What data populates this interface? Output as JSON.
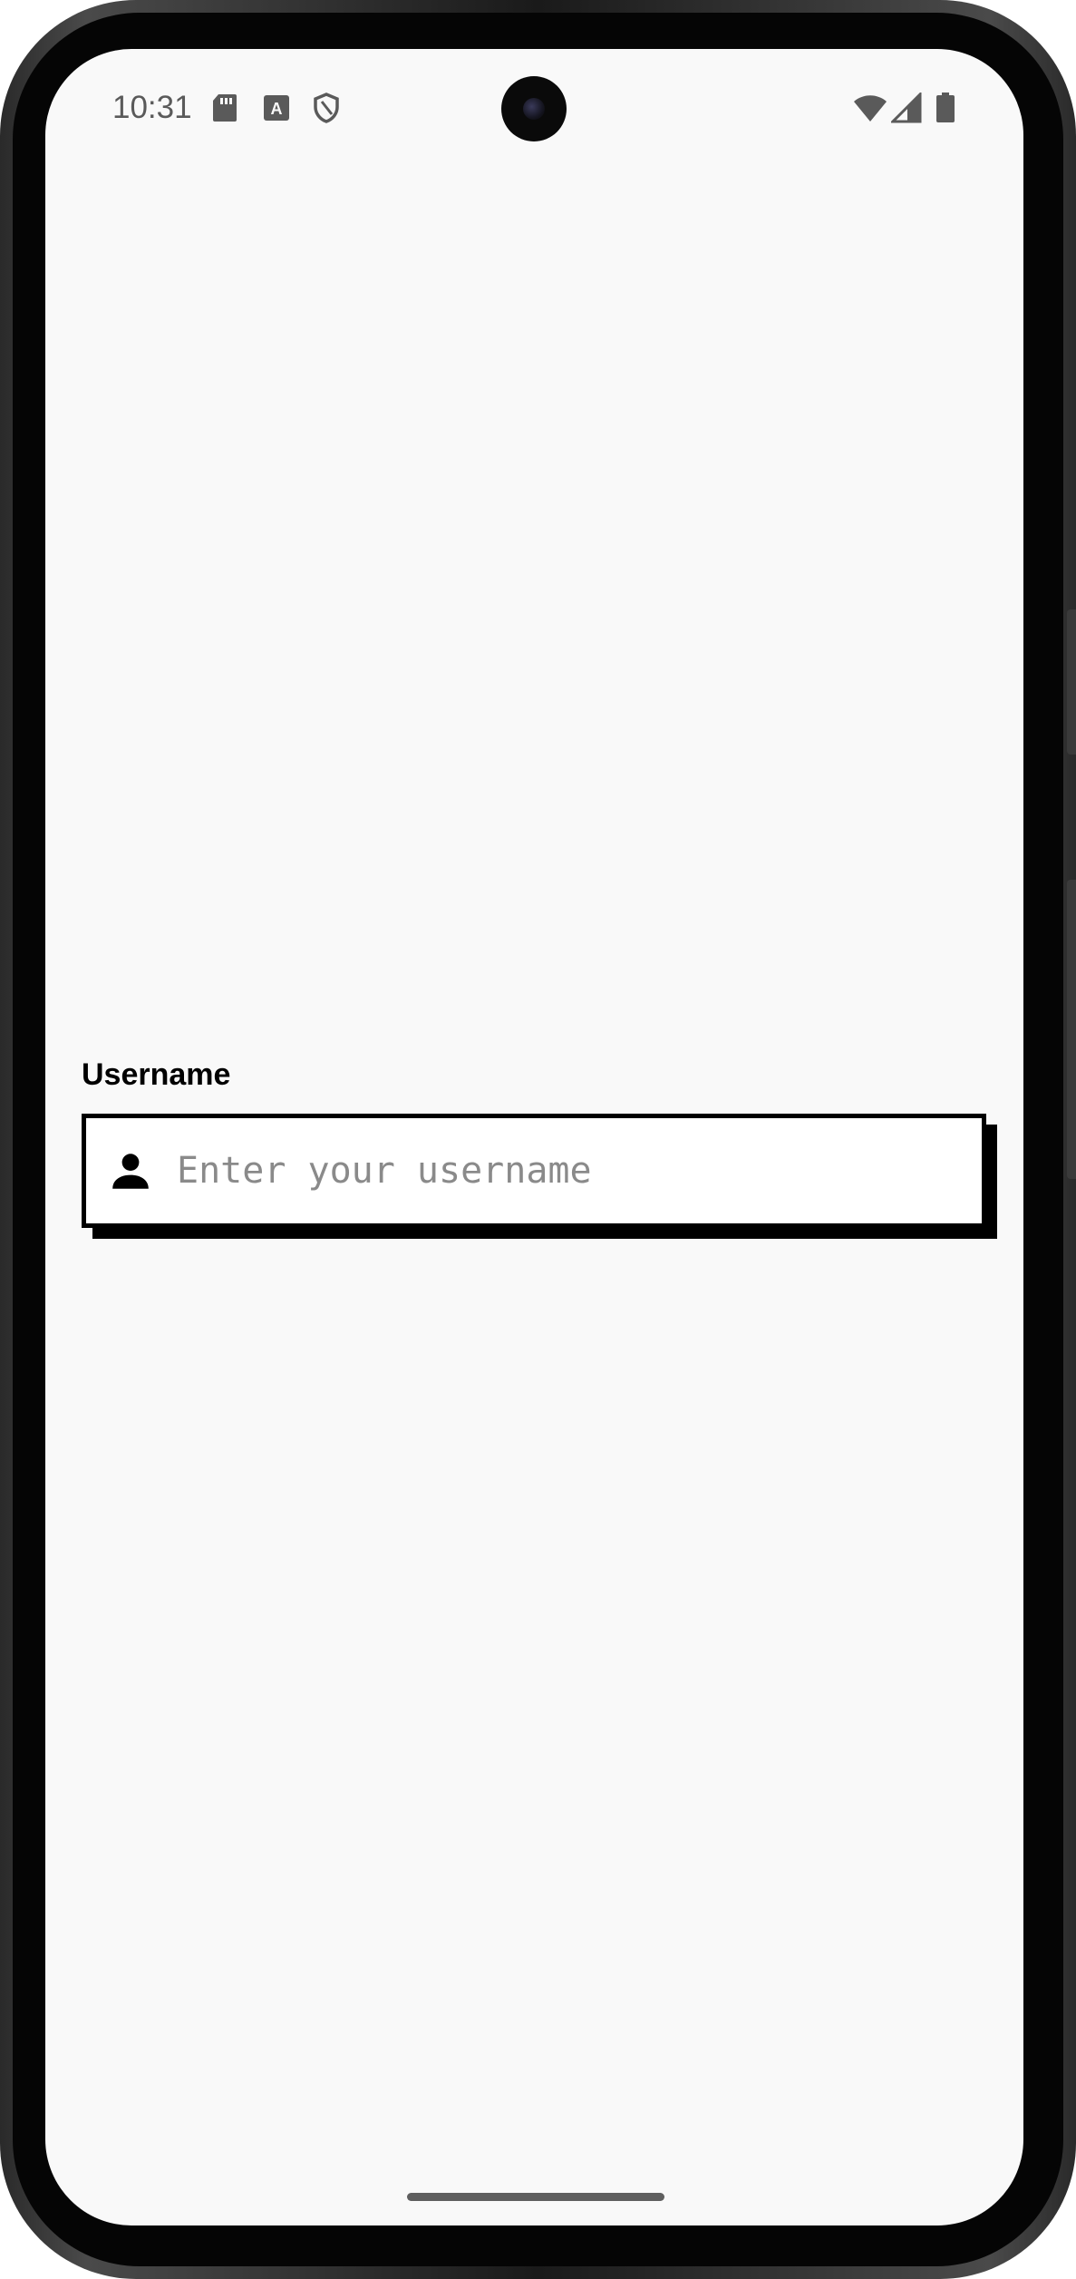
{
  "status_bar": {
    "time": "10:31",
    "left_icons": [
      "sd-card-icon",
      "text-a-icon",
      "shield-icon"
    ],
    "right_icons": [
      "wifi-icon",
      "cellular-signal-icon",
      "battery-icon"
    ]
  },
  "form": {
    "username_label": "Username",
    "username_placeholder": "Enter your username",
    "username_value": "",
    "username_icon": "person-icon"
  },
  "colors": {
    "background": "#f9f9f9",
    "border": "#000000",
    "placeholder": "#8a8a8a",
    "status_text": "#5a5a5a"
  }
}
